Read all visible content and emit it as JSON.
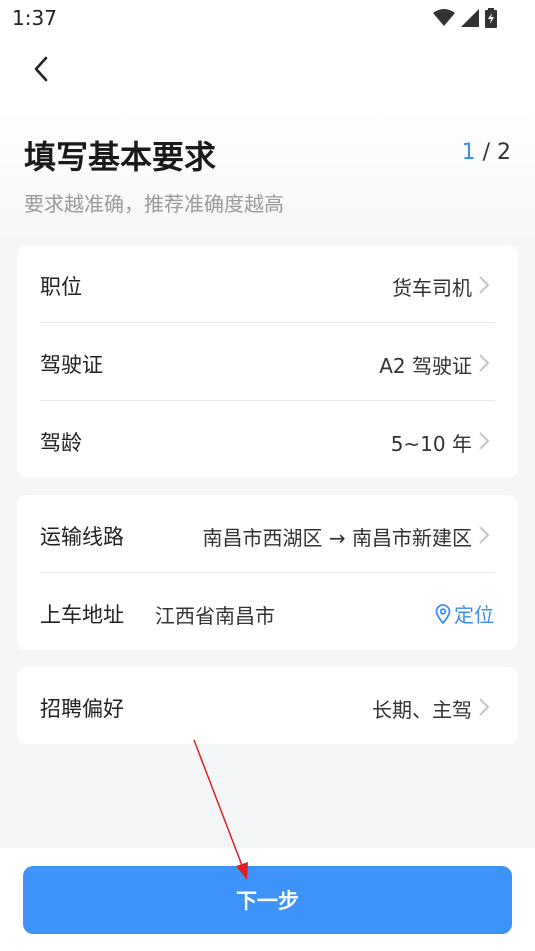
{
  "status": {
    "time": "1:37"
  },
  "header": {
    "title": "填写基本要求",
    "step_current": "1",
    "step_total": " / 2",
    "subtitle": "要求越准确，推荐准确度越高"
  },
  "card1": {
    "rows": [
      {
        "label": "职位",
        "value": "货车司机"
      },
      {
        "label": "驾驶证",
        "value": "A2 驾驶证"
      },
      {
        "label": "驾龄",
        "value": "5~10 年"
      }
    ]
  },
  "card2": {
    "route": {
      "label": "运输线路",
      "value": "南昌市西湖区 → 南昌市新建区"
    },
    "pickup": {
      "label": "上车地址",
      "value": "江西省南昌市",
      "locate_label": "定位"
    }
  },
  "card3": {
    "preference": {
      "label": "招聘偏好",
      "value": "长期、主驾"
    }
  },
  "footer": {
    "next_label": "下一步"
  },
  "colors": {
    "accent": "#3d93f8",
    "annotation_arrow": "#e02020"
  }
}
